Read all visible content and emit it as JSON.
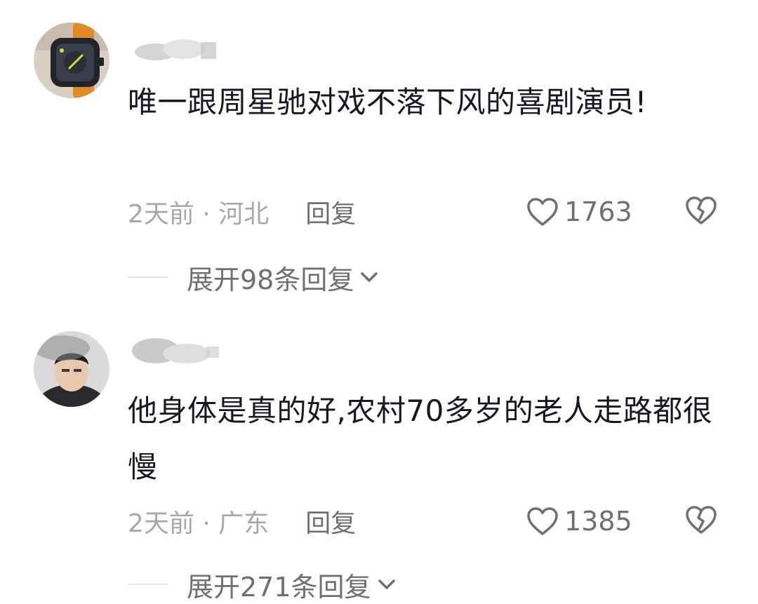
{
  "comments": [
    {
      "text": "唯一跟周星驰对戏不落下风的喜剧演员!",
      "time_location": "2天前 · 河北",
      "reply_label": "回复",
      "like_count": "1763",
      "expand_label": "展开98条回复"
    },
    {
      "text": "他身体是真的好,农村70多岁的老人走路都很慢",
      "time_location": "2天前 · 广东",
      "reply_label": "回复",
      "like_count": "1385",
      "expand_label": "展开271条回复"
    }
  ],
  "icons": {
    "like": "heart-outline-icon",
    "dislike": "broken-heart-icon",
    "expand": "chevron-down-icon"
  },
  "colors": {
    "text": "#161823",
    "meta": "#a7a8ac",
    "secondary": "#6e7074"
  }
}
